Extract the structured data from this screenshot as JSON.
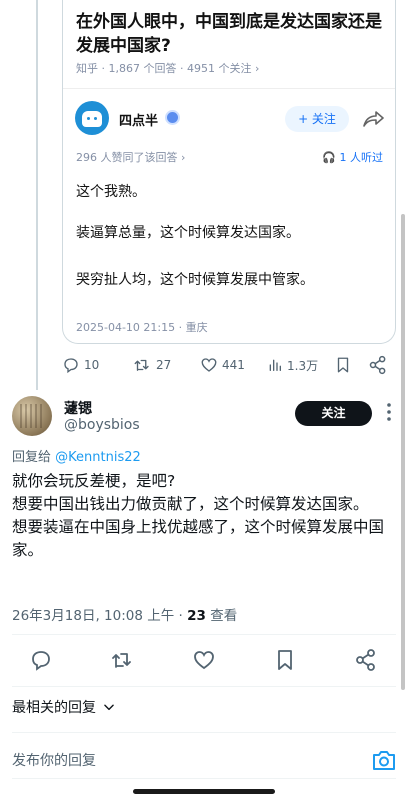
{
  "quoted_post": {
    "question_title": "在外国人眼中，中国到底是发达国家还是发展中国家?",
    "question_meta": "知乎 · 1,867 个回答 · 4951 个关注 ›",
    "author": "四点半",
    "follow_label": "+ 关注",
    "agree_text": "296 人赞同了该回答 ›",
    "listen_text": "1 人听过",
    "paragraphs": [
      "这个我熟。",
      "装逼算总量，这个时候算发达国家。",
      "哭穷扯人均，这个时候算发展中管家。"
    ],
    "date": "2025-04-10 21:15 · 重庆"
  },
  "quoted_actions": {
    "replies": "10",
    "reposts": "27",
    "likes": "441",
    "views": "1.3万"
  },
  "reply": {
    "display_name": "蘧锶",
    "handle": "@boysbios",
    "follow_label": "关注",
    "replying_prefix": "回复给",
    "replying_to": "@Kenntnis22",
    "text_lines": [
      "就你会玩反差梗，是吧?",
      "想要中国出钱出力做贡献了，这个时候算发达国家。",
      "想要装逼在中国身上找优越感了，这个时候算发展中国家。"
    ],
    "timestamp": "26年3月18日, 10:08 上午 · ",
    "views_count": "23",
    "views_label": " 查看"
  },
  "sort_label": "最相关的回复",
  "compose_placeholder": "发布你的回复",
  "colors": {
    "accent": "#1d9bf0",
    "zhihu_blue": "#1772f6",
    "text": "#0f1419",
    "muted": "#536471"
  }
}
